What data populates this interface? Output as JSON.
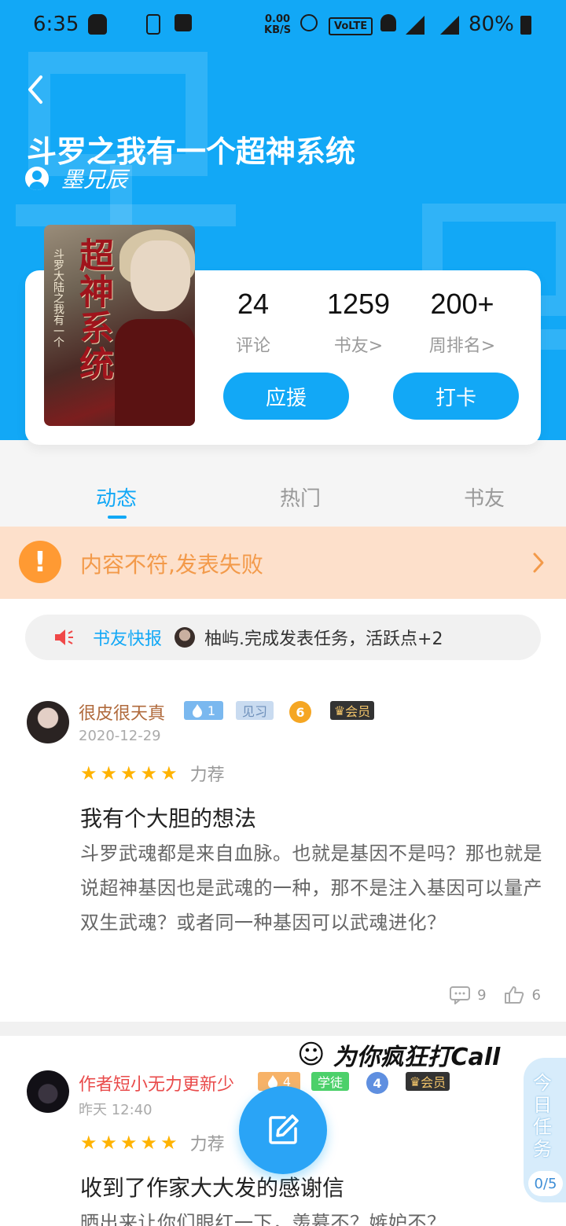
{
  "status_bar": {
    "time": "6:35",
    "kb": "0.00\nKB/S",
    "volte": "VoLTE",
    "battery": "80%"
  },
  "book": {
    "title": "斗罗之我有一个超神系统",
    "author": "墨兄辰",
    "cover_title": "超神系统",
    "cover_subtitle": "斗罗大陆之我有一个"
  },
  "stats": [
    {
      "value": "24",
      "label": "评论"
    },
    {
      "value": "1259",
      "label": "书友>"
    },
    {
      "value": "200+",
      "label": "周排名>"
    }
  ],
  "buttons": {
    "support": "应援",
    "checkin": "打卡"
  },
  "tabs": [
    {
      "label": "动态"
    },
    {
      "label": "热门"
    },
    {
      "label": "书友"
    }
  ],
  "error_banner": {
    "icon": "!",
    "text": "内容不符,发表失败"
  },
  "news": {
    "label": "书友快报",
    "text": "柚屿.完成发表任务，活跃点+2"
  },
  "posts": [
    {
      "user": "很皮很天真",
      "level": "1",
      "rank_badge": "见习",
      "vip_level": "6",
      "member": "会员",
      "time": "2020-12-29",
      "tag": "力荐",
      "title": "我有个大胆的想法",
      "body": "斗罗武魂都是来自血脉。也就是基因不是吗？那也就是说超神基因也是武魂的一种，那不是注入基因可以量产双生武魂？或者同一种基因可以武魂进化？",
      "comments": "9",
      "likes": "6"
    },
    {
      "user": "作者短小无力更新少",
      "level": "4",
      "rank_badge": "学徒",
      "vip_level": "4",
      "member": "会员",
      "time": "昨天 12:40",
      "tag": "力荐",
      "title": "收到了作家大大发的感谢信",
      "body": "晒出来让你们眼红一下，羡慕不？嫉妒不？"
    }
  ],
  "floating": {
    "call_banner": "为你疯狂打Call",
    "task_label": "今日任务",
    "task_count": "0/5"
  },
  "colors": {
    "primary": "#12a8f6",
    "warning": "#ff9a33",
    "star": "#ffb300"
  }
}
